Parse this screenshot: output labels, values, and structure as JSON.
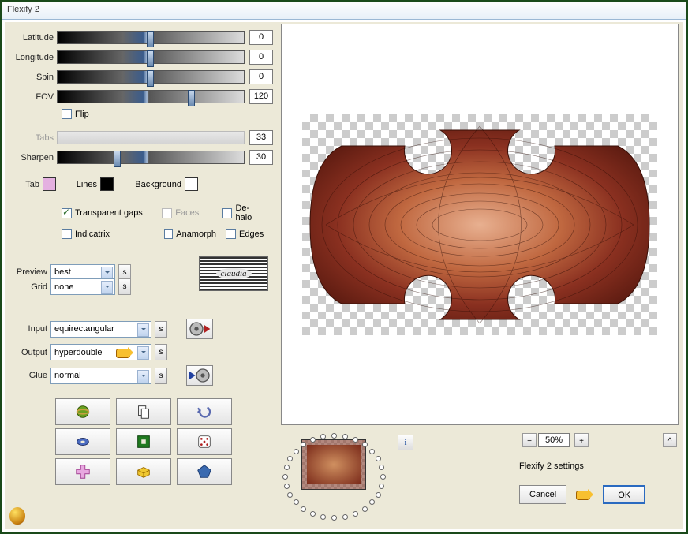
{
  "window": {
    "title": "Flexify 2"
  },
  "sliders": {
    "latitude": {
      "label": "Latitude",
      "value": "0"
    },
    "longitude": {
      "label": "Longitude",
      "value": "0"
    },
    "spin": {
      "label": "Spin",
      "value": "0"
    },
    "fov": {
      "label": "FOV",
      "value": "120"
    },
    "tabs": {
      "label": "Tabs",
      "value": "33"
    },
    "sharpen": {
      "label": "Sharpen",
      "value": "30"
    }
  },
  "checks": {
    "flip": "Flip",
    "transparent_gaps": "Transparent gaps",
    "faces": "Faces",
    "dehalo": "De-halo",
    "indicatrix": "Indicatrix",
    "anamorph": "Anamorph",
    "edges": "Edges"
  },
  "color_labels": {
    "tab": "Tab",
    "lines": "Lines",
    "background": "Background"
  },
  "colors": {
    "tab": "#e4b0e0",
    "lines": "#000000",
    "background": "#ffffff"
  },
  "preview_label": "Preview",
  "preview_value": "best",
  "grid_label": "Grid",
  "grid_value": "none",
  "input_label": "Input",
  "input_value": "equirectangular",
  "output_label": "Output",
  "output_value": "hyperdouble",
  "glue_label": "Glue",
  "glue_value": "normal",
  "logo": "claudia",
  "zoom": {
    "minus": "−",
    "value": "50%",
    "plus": "+"
  },
  "collapse": "^",
  "settings_text": "Flexify 2 settings",
  "buttons": {
    "cancel": "Cancel",
    "ok": "OK"
  },
  "info": "i",
  "reset_sym": "s"
}
